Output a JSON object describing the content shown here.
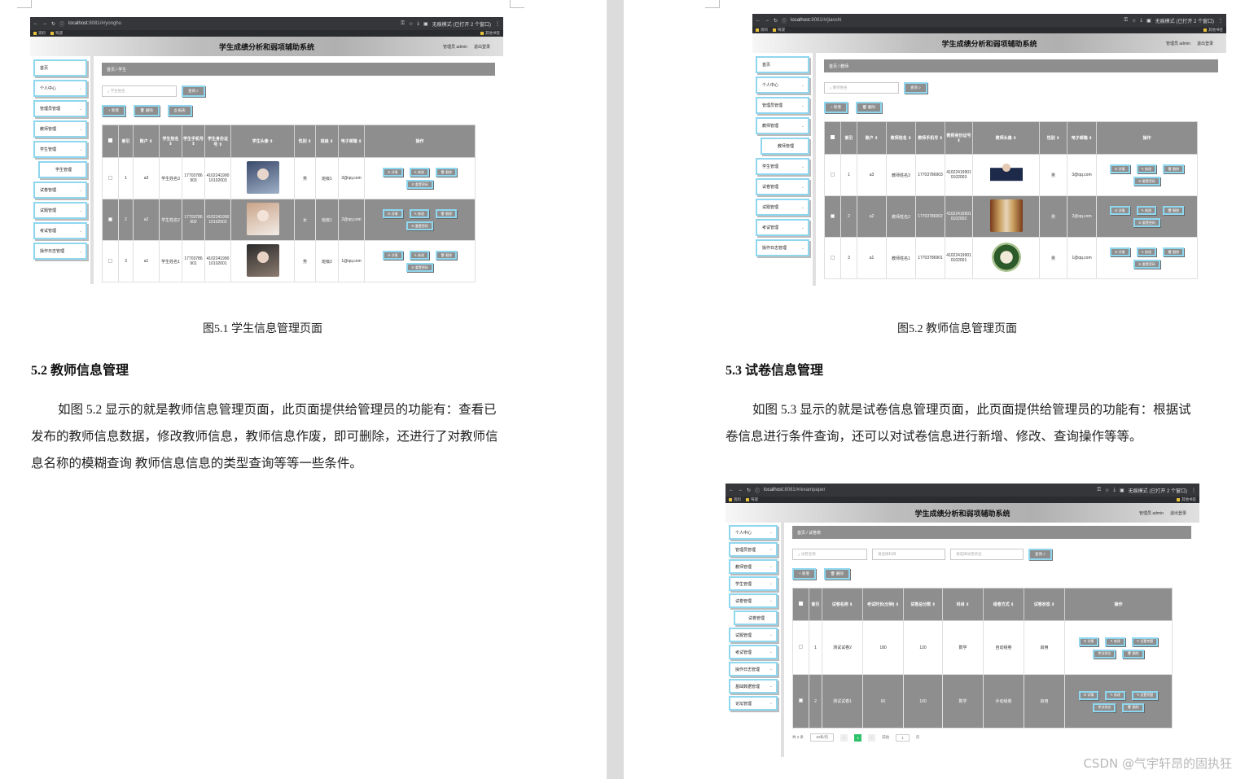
{
  "left_page": {
    "figure_caption": "图5.1 学生信息管理页面",
    "section_heading": "5.2 教师信息管理",
    "paragraph": "如图 5.2 显示的就是教师信息管理页面，此页面提供给管理员的功能有：查看已发布的教师信息数据，修改教师信息，教师信息作废，即可删除，还进行了对教师信息名称的模糊查询 教师信息信息的类型查询等等一些条件。"
  },
  "right_page": {
    "figure_caption": "图5.2 教师信息管理页面",
    "section_heading": "5.3 试卷信息管理",
    "paragraph": "如图 5.3 显示的就是试卷信息管理页面，此页面提供给管理员的功能有：根据试卷信息进行条件查询，还可以对试卷信息进行新增、修改、查询操作等等。"
  },
  "watermark": "CSDN @气宇轩昂的固执狂",
  "app": {
    "title": "学生成绩分析和弱项辅助系统",
    "user": "管理员 admin",
    "logout": "退出登录",
    "incognito": "无痕模式 (已打开 2 个窗口)",
    "bookmarks": [
      "资料",
      "驾驭"
    ],
    "bookmarks_right": "其他书签"
  },
  "shot1": {
    "url_host": "localhost",
    "url_path": ":8081/#/yonghu",
    "sidebar": [
      {
        "label": "首页",
        "sub": false,
        "arrow": false
      },
      {
        "label": "个人中心",
        "sub": false,
        "arrow": true
      },
      {
        "label": "管理员管理",
        "sub": false,
        "arrow": true
      },
      {
        "label": "教师管理",
        "sub": false,
        "arrow": true
      },
      {
        "label": "学生管理",
        "sub": false,
        "arrow": true
      },
      {
        "label": "学生管理",
        "sub": true,
        "arrow": false
      },
      {
        "label": "试卷管理",
        "sub": false,
        "arrow": true
      },
      {
        "label": "试题管理",
        "sub": false,
        "arrow": true
      },
      {
        "label": "考试管理",
        "sub": false,
        "arrow": true
      },
      {
        "label": "操作日志管理",
        "sub": false,
        "arrow": true
      }
    ],
    "breadcrumb": "首页 / 学生",
    "search_placeholder": "学生姓名",
    "search_button": "查询 ⌕",
    "buttons": [
      "+ 新增",
      "🗑 删除",
      "⎙ 报表"
    ],
    "headers": [
      "",
      "索引",
      "账户 ⇕",
      "学生姓名 ⇕",
      "学生手机号 ⇕",
      "学生身份证号 ⇕",
      "学生头像 ⇕",
      "性别 ⇕",
      "班级 ⇕",
      "电子邮箱 ⇕",
      "操作"
    ],
    "rows": [
      [
        "1",
        "a3",
        "学生姓名3",
        "17703786903",
        "410224199010102003",
        "",
        "男",
        "班级1",
        "3@qq.com"
      ],
      [
        "2",
        "a2",
        "学生姓名2",
        "17703786902",
        "410224199010102002",
        "",
        "女",
        "班级1",
        "2@qq.com"
      ],
      [
        "3",
        "a1",
        "学生姓名1",
        "17703786901",
        "410224199010102001",
        "",
        "男",
        "班级2",
        "1@qq.com"
      ]
    ],
    "ops": [
      "☰ 详情",
      "✎ 修改",
      "🗑 删除",
      "☰ 重置密码"
    ]
  },
  "shot2": {
    "url_host": "localhost",
    "url_path": ":8081/#/jiaoshi",
    "sidebar": [
      {
        "label": "首页",
        "sub": false,
        "arrow": false
      },
      {
        "label": "个人中心",
        "sub": false,
        "arrow": true
      },
      {
        "label": "管理员管理",
        "sub": false,
        "arrow": true
      },
      {
        "label": "教师管理",
        "sub": false,
        "arrow": true
      },
      {
        "label": "教师管理",
        "sub": true,
        "arrow": false
      },
      {
        "label": "学生管理",
        "sub": false,
        "arrow": true
      },
      {
        "label": "试卷管理",
        "sub": false,
        "arrow": true
      },
      {
        "label": "试题管理",
        "sub": false,
        "arrow": true
      },
      {
        "label": "考试管理",
        "sub": false,
        "arrow": true
      },
      {
        "label": "操作日志管理",
        "sub": false,
        "arrow": true
      }
    ],
    "breadcrumb": "首页 / 教师",
    "search_placeholder": "教师姓名",
    "search_button": "查询 ⌕",
    "buttons": [
      "+ 新增",
      "🗑 删除"
    ],
    "headers": [
      "",
      "索引",
      "账户 ⇕",
      "教师姓名 ⇕",
      "教师手机号 ⇕",
      "教师身份证号 ⇕",
      "教师头像 ⇕",
      "性别 ⇕",
      "电子邮箱 ⇕",
      "操作"
    ],
    "rows": [
      [
        "1",
        "a3",
        "教师姓名3",
        "17703786903",
        "410224199010102003",
        "",
        "男",
        "3@qq.com"
      ],
      [
        "2",
        "a2",
        "教师姓名2",
        "17703786902",
        "410224199010102002",
        "",
        "男",
        "2@qq.com"
      ],
      [
        "3",
        "a1",
        "教师姓名1",
        "17703786901",
        "410224199010102001",
        "",
        "男",
        "1@qq.com"
      ]
    ],
    "ops": [
      "☰ 详情",
      "✎ 修改",
      "🗑 删除",
      "☰ 重置密码"
    ]
  },
  "shot3": {
    "url_host": "localhost",
    "url_path": ":8081/#/exampaper",
    "sidebar": [
      {
        "label": "个人中心",
        "sub": false,
        "arrow": true
      },
      {
        "label": "管理员管理",
        "sub": false,
        "arrow": true
      },
      {
        "label": "教师管理",
        "sub": false,
        "arrow": true
      },
      {
        "label": "学生管理",
        "sub": false,
        "arrow": true
      },
      {
        "label": "试卷管理",
        "sub": false,
        "arrow": true
      },
      {
        "label": "试卷管理",
        "sub": true,
        "arrow": false
      },
      {
        "label": "试题管理",
        "sub": false,
        "arrow": true
      },
      {
        "label": "考试管理",
        "sub": false,
        "arrow": true
      },
      {
        "label": "操作日志管理",
        "sub": false,
        "arrow": true
      },
      {
        "label": "基础数据管理",
        "sub": false,
        "arrow": true
      },
      {
        "label": "论坛管理",
        "sub": false,
        "arrow": true
      }
    ],
    "breadcrumb": "首页 / 试卷表",
    "search_placeholder": "试卷名称",
    "select1": "请选择科目",
    "select2": "请选择试卷状态",
    "search_button": "查询 ⌕",
    "buttons": [
      "+ 新增",
      "🗑 删除"
    ],
    "headers": [
      "",
      "索引",
      "试卷名称 ⇕",
      "考试时长(分钟) ⇕",
      "试卷总分数 ⇕",
      "科目 ⇕",
      "组卷方式 ⇕",
      "试卷状态 ⇕",
      "操作"
    ],
    "rows": [
      [
        "1",
        "测试试卷2",
        "180",
        "120",
        "数学",
        "自动组卷",
        "启用"
      ],
      [
        "2",
        "测试试卷1",
        "60",
        "100",
        "数学",
        "手动组卷",
        "启用"
      ]
    ],
    "ops": [
      "☰ 详情",
      "✎ 修改",
      "✎ 设置考题",
      "考试排名",
      "🗑 删除"
    ],
    "pagination": {
      "total": "共 2 条",
      "page_size": "10条/页",
      "current": "1",
      "goto": "前往",
      "goto_value": "1",
      "page_unit": "页"
    }
  }
}
